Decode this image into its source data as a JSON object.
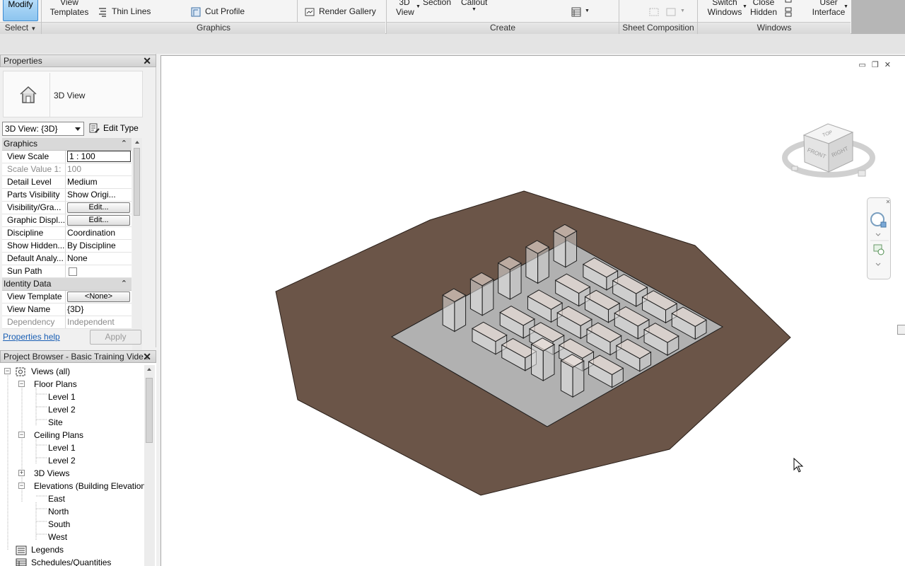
{
  "ribbon": {
    "modify": "Modify",
    "view_templates": [
      "View",
      "Templates"
    ],
    "thin_lines": "Thin Lines",
    "cut_profile": "Cut Profile",
    "render_gallery": "Render Gallery",
    "view_3d": [
      "3D",
      "View"
    ],
    "section": "Section",
    "callout": "Callout",
    "switch_windows": [
      "Switch",
      "Windows"
    ],
    "close_hidden": [
      "Close",
      "Hidden"
    ],
    "user_interface": [
      "User",
      "Interface"
    ],
    "panels": {
      "select": "Select",
      "graphics": "Graphics",
      "create": "Create",
      "sheet_composition": "Sheet Composition",
      "windows": "Windows"
    }
  },
  "properties": {
    "title": "Properties",
    "type_name": "3D View",
    "view_selector": "3D View: {3D}",
    "edit_type": "Edit Type",
    "categories": {
      "graphics": "Graphics",
      "identity": "Identity Data"
    },
    "rows": [
      {
        "key": "View Scale",
        "value": "1 : 100"
      },
      {
        "key": "Scale Value    1:",
        "value": "100"
      },
      {
        "key": "Detail Level",
        "value": "Medium"
      },
      {
        "key": "Parts Visibility",
        "value": "Show Origi..."
      },
      {
        "key": "Visibility/Gra...",
        "value": "Edit..."
      },
      {
        "key": "Graphic Displ...",
        "value": "Edit..."
      },
      {
        "key": "Discipline",
        "value": "Coordination"
      },
      {
        "key": "Show Hidden...",
        "value": "By Discipline"
      },
      {
        "key": "Default Analy...",
        "value": "None"
      },
      {
        "key": "Sun Path",
        "value": ""
      },
      {
        "key": "View Template",
        "value": "<None>"
      },
      {
        "key": "View Name",
        "value": "{3D}"
      },
      {
        "key": "Dependency",
        "value": "Independent"
      }
    ],
    "help": "Properties help",
    "apply": "Apply"
  },
  "browser": {
    "title": "Project Browser - Basic Training Vide...",
    "items": [
      {
        "label": "Views (all)",
        "level": 0
      },
      {
        "label": "Floor Plans",
        "level": 1
      },
      {
        "label": "Level 1",
        "level": 2
      },
      {
        "label": "Level 2",
        "level": 2
      },
      {
        "label": "Site",
        "level": 2
      },
      {
        "label": "Ceiling Plans",
        "level": 1
      },
      {
        "label": "Level 1",
        "level": 2
      },
      {
        "label": "Level 2",
        "level": 2
      },
      {
        "label": "3D Views",
        "level": 1
      },
      {
        "label": "Elevations (Building Elevation",
        "level": 1
      },
      {
        "label": "East",
        "level": 2
      },
      {
        "label": "North",
        "level": 2
      },
      {
        "label": "South",
        "level": 2
      },
      {
        "label": "West",
        "level": 2
      },
      {
        "label": "Legends",
        "level": 0
      },
      {
        "label": "Schedules/Quantities",
        "level": 0
      }
    ]
  },
  "viewcube": {
    "top": "TOP",
    "front": "FRONT",
    "right": "RIGHT"
  },
  "colors": {
    "ground": "#6b5548",
    "slab": "#b1b1b1",
    "selected": "#9ecdf2"
  }
}
